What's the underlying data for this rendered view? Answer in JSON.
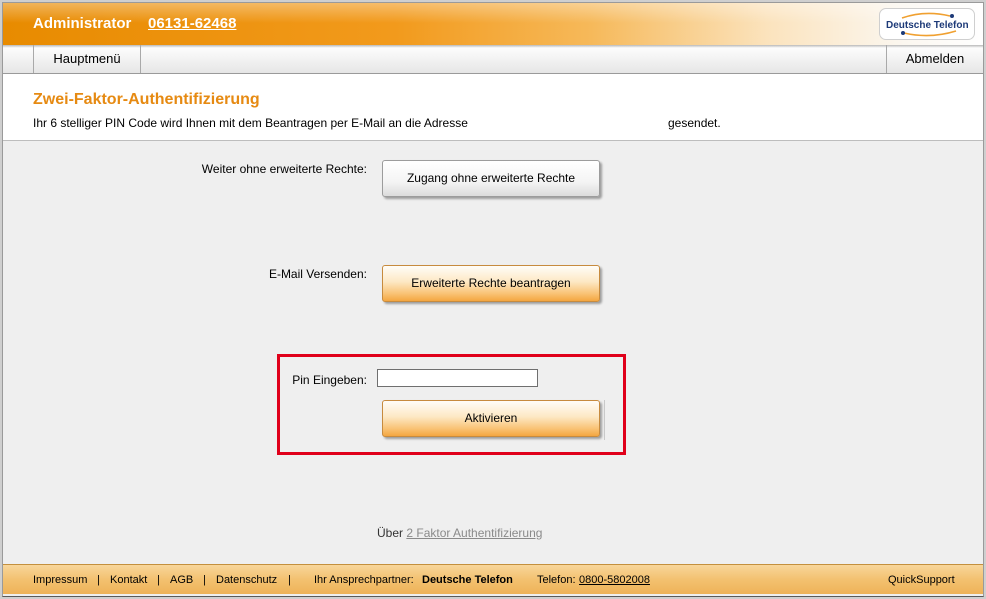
{
  "header": {
    "user_label": "Administrator",
    "phone": "06131-62468",
    "logo_text": "Deutsche Telefon"
  },
  "nav": {
    "main_menu": "Hauptmenü",
    "logout": "Abmelden"
  },
  "page": {
    "title": "Zwei-Faktor-Authentifizierung",
    "intro_text": "Ihr 6 stelliger PIN Code wird Ihnen mit dem Beantragen per E-Mail an die Adresse",
    "intro_suffix": "gesendet."
  },
  "form": {
    "continue_label": "Weiter ohne erweiterte Rechte:",
    "continue_button": "Zugang ohne erweiterte Rechte",
    "email_label": "E-Mail Versenden:",
    "email_button": "Erweiterte Rechte beantragen",
    "pin_label": "Pin Eingeben:",
    "pin_value": "",
    "activate_button": "Aktivieren",
    "about_prefix": "Über",
    "about_link": "2 Faktor Authentifizierung"
  },
  "footer": {
    "links": [
      "Impressum",
      "Kontakt",
      "AGB",
      "Datenschutz"
    ],
    "separator": "|",
    "contact_label": "Ihr Ansprechpartner:",
    "contact_name": "Deutsche Telefon",
    "phone_label": "Telefon:",
    "phone_number": "0800-5802008",
    "quicksupport": "QuickSupport"
  },
  "colors": {
    "accent_orange": "#e68a12",
    "highlight_red": "#e0001a",
    "logo_blue": "#1d3a78"
  }
}
